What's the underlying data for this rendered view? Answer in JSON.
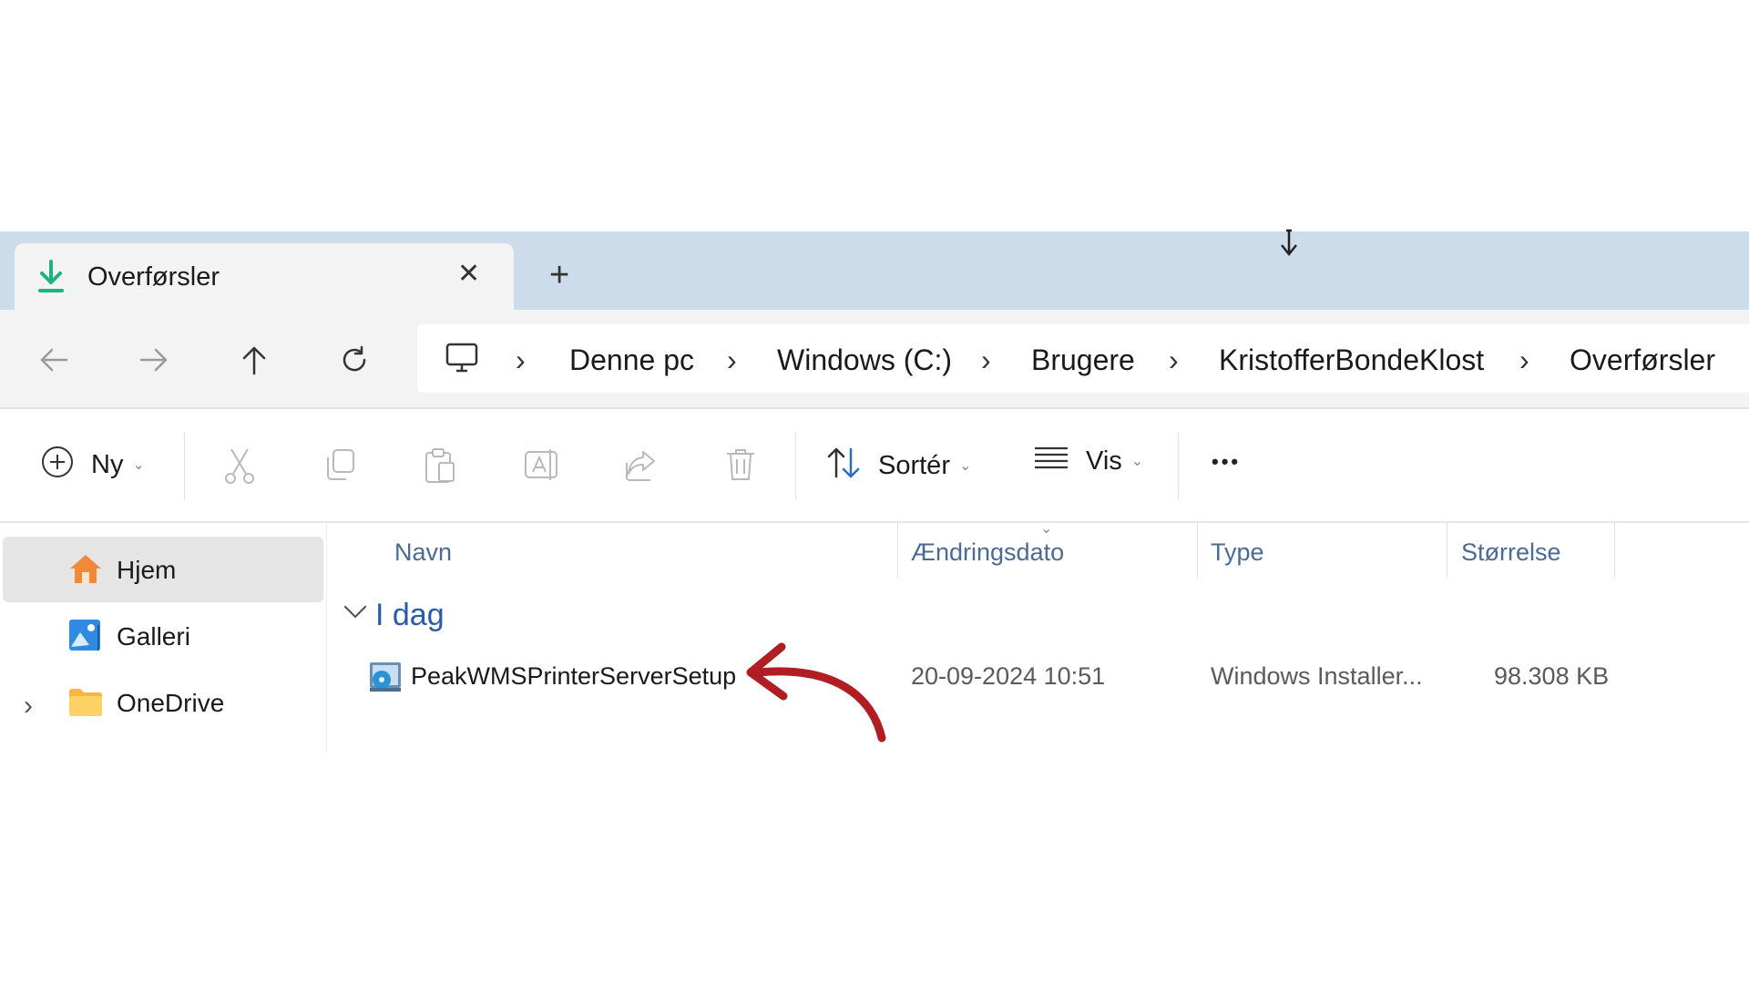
{
  "tab": {
    "title": "Overførsler",
    "close_glyph": "✕",
    "new_glyph": "+"
  },
  "breadcrumb": [
    "Denne pc",
    "Windows (C:)",
    "Brugere",
    "KristofferBondeKlost",
    "Overførsler"
  ],
  "toolbar": {
    "new_label": "Ny",
    "sort_label": "Sortér",
    "view_label": "Vis",
    "more_glyph": "•••"
  },
  "nav_pane": {
    "items": [
      {
        "label": "Hjem",
        "icon": "home-icon",
        "selected": true
      },
      {
        "label": "Galleri",
        "icon": "gallery-icon"
      },
      {
        "label": "OneDrive",
        "icon": "folder-icon",
        "expandable": true
      }
    ]
  },
  "columns": [
    "Navn",
    "Ændringsdato",
    "Type",
    "Størrelse"
  ],
  "group": {
    "title": "I dag"
  },
  "files": [
    {
      "name": "PeakWMSPrinterServerSetup",
      "modified": "20-09-2024 10:51",
      "type": "Windows Installer...",
      "size": "98.308 KB",
      "icon": "msi-installer-icon"
    }
  ],
  "colors": {
    "accent": "#2b5aa8",
    "tabstrip": "#cddcea",
    "annotation_arrow": "#b01e23",
    "download_icon": "#1db57c"
  }
}
